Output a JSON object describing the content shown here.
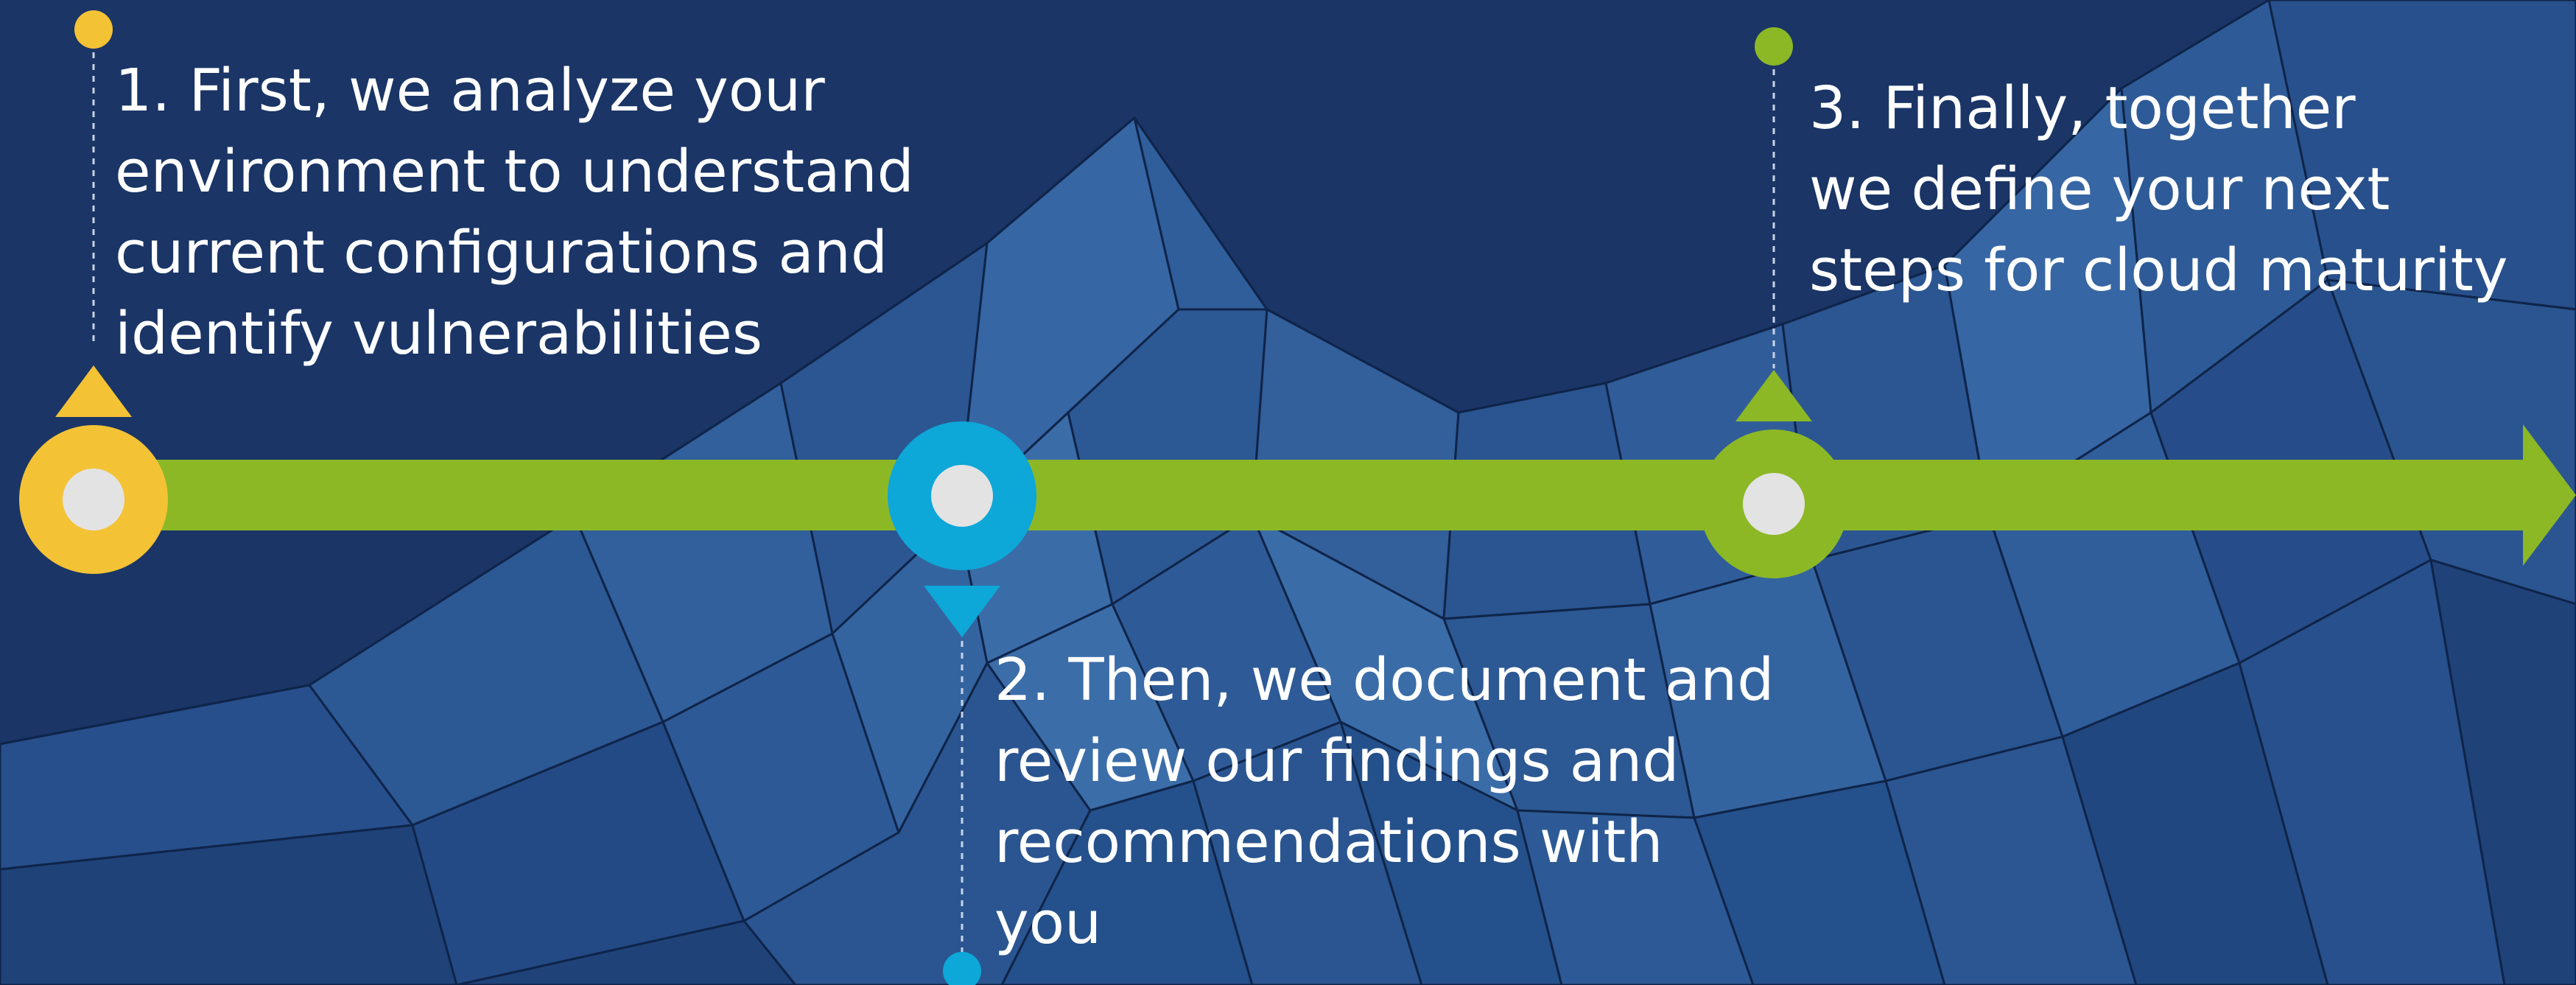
{
  "steps": [
    {
      "text": "1. First, we analyze your\nenvironment to understand\ncurrent configurations and\nidentify vulnerabilities",
      "color": "#f4c235"
    },
    {
      "text": "2. Then, we document and\nreview our findings and\nrecommendations with\nyou",
      "color": "#0da7d8"
    },
    {
      "text": "3. Finally, together\nwe define your next\nsteps for cloud maturity",
      "color": "#8cb826"
    }
  ],
  "colors": {
    "background": "#1a3566",
    "timeline": "#8cb826",
    "node_center": "#e3e3e3",
    "text": "#ffffff"
  }
}
